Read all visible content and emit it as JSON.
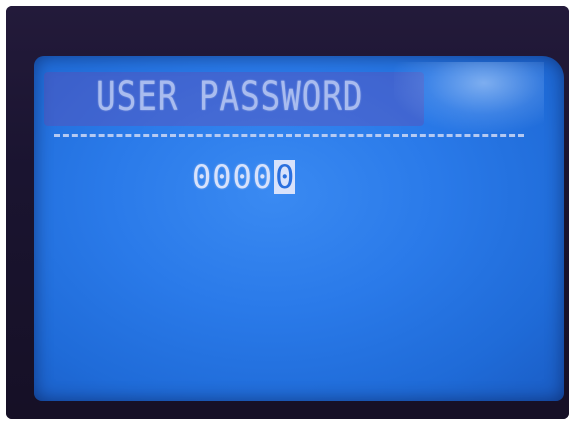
{
  "screen": {
    "title": "USER PASSWORD",
    "password": {
      "entered_digits": "0000",
      "cursor_digit": "0"
    }
  },
  "colors": {
    "lcd_background": "#2a7ae9",
    "lcd_text": "#d8e2fb",
    "bezel": "#1a1430"
  }
}
